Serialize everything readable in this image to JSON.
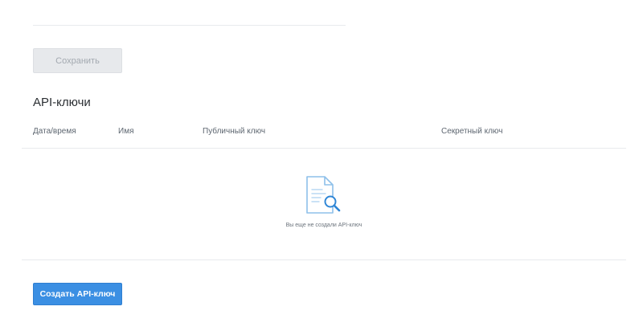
{
  "form": {
    "save_label": "Сохранить"
  },
  "api_keys": {
    "title": "API-ключи",
    "columns": {
      "datetime": "Дата/время",
      "name": "Имя",
      "public_key": "Публичный ключ",
      "secret_key": "Секретный ключ"
    },
    "empty_icon": "document-search-icon",
    "empty_text": "Вы еще не создали API-ключ",
    "create_label": "Создать API-ключ"
  },
  "colors": {
    "primary": "#3b8fe3",
    "icon_outline": "#8ec0ea",
    "icon_magnifier": "#2f86d6"
  }
}
